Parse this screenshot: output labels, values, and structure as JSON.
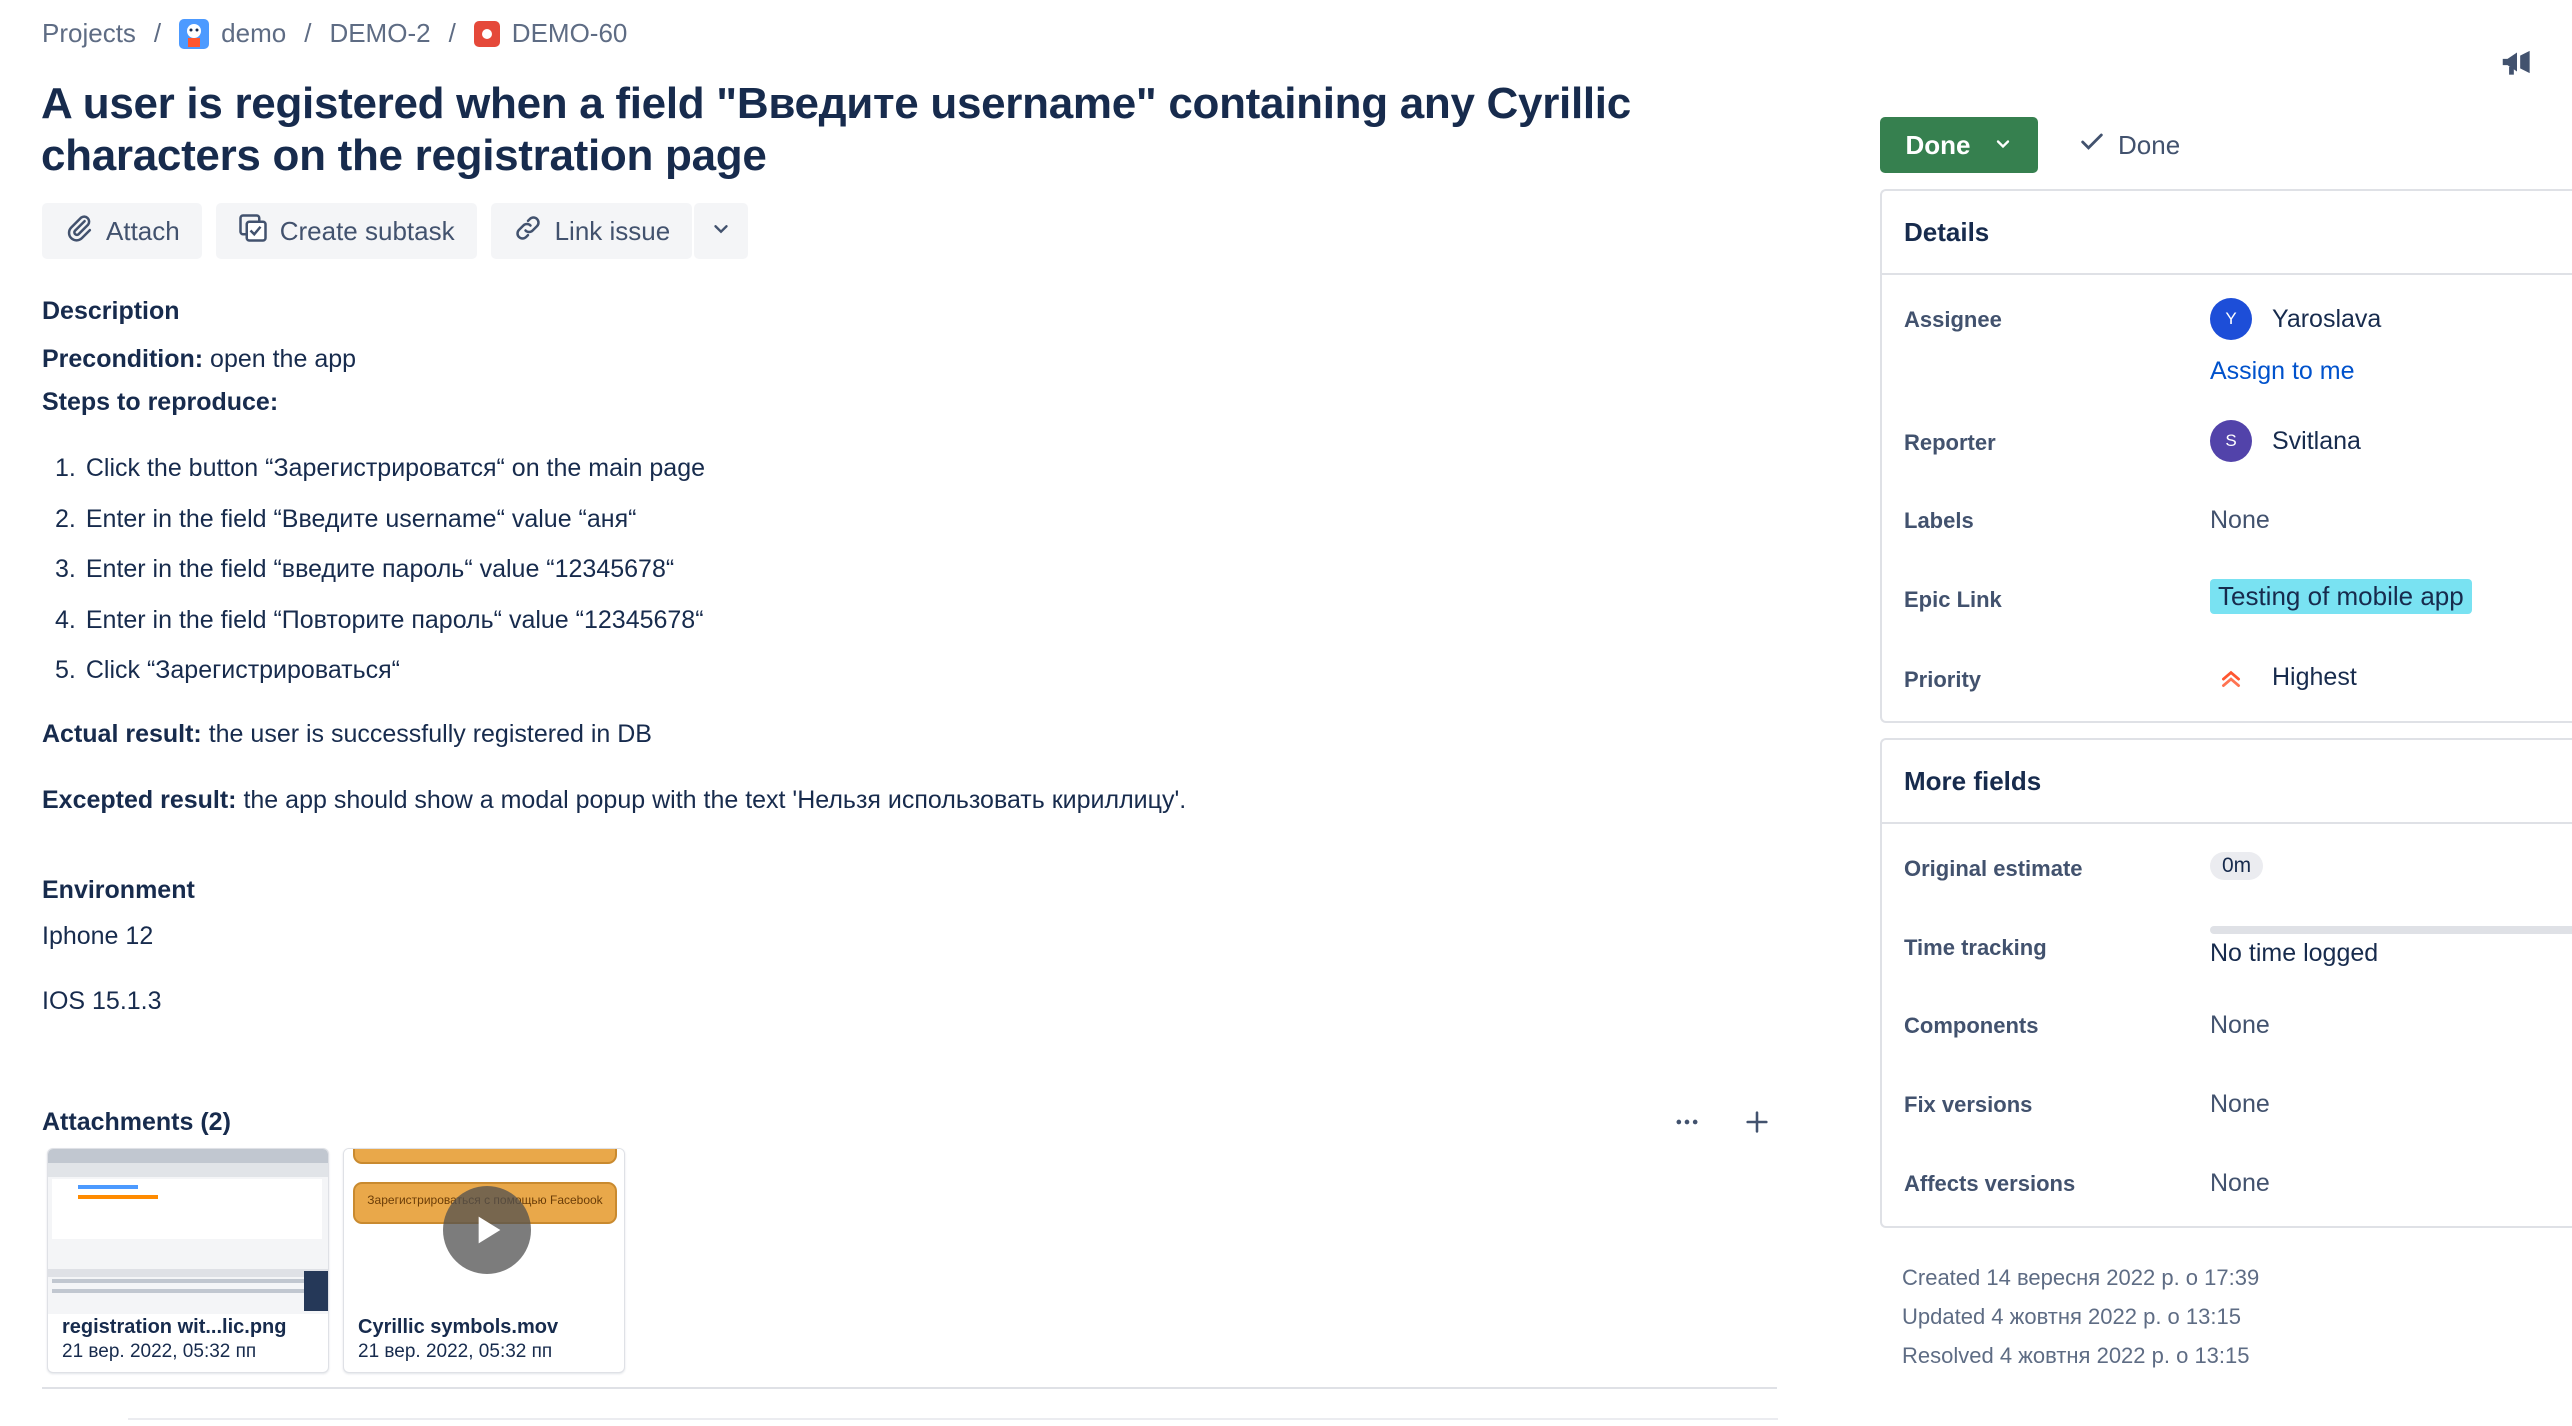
{
  "breadcrumbs": {
    "projects": "Projects",
    "project": "demo",
    "epic": "DEMO-2",
    "issue": "DEMO-60",
    "separator": "/"
  },
  "title": "A user is registered when a field \"Введите username\" containing any Cyrillic characters on the registration page",
  "toolbar": {
    "attach": "Attach",
    "create_subtask": "Create subtask",
    "link_issue": "Link issue"
  },
  "description": {
    "heading": "Description",
    "precondition_label": "Precondition:",
    "precondition_value": " open the app",
    "steps_label": "Steps to reproduce:",
    "steps": [
      {
        "num": "1.",
        "text": "Click the button “Зарегистрироватся“ on the main page"
      },
      {
        "num": "2.",
        "text": "Enter in the field “Введите username“ value “аня“"
      },
      {
        "num": "3.",
        "text": "Enter in the field “введите пароль“ value “12345678“"
      },
      {
        "num": "4.",
        "text": "Enter in the field “Повторите пароль“ value “12345678“"
      },
      {
        "num": "5.",
        "text": "Click “Зарегистрироваться“"
      }
    ],
    "actual_label": "Actual result:",
    "actual_value": " the user is successfully registered in DB",
    "expected_label": "Excepted result:",
    "expected_value": " the app should show a modal popup with the text 'Нельзя использовать кириллицу'."
  },
  "environment": {
    "heading": "Environment",
    "device": "Iphone 12",
    "os": "IOS 15.1.3"
  },
  "attachments": {
    "heading": "Attachments (2)",
    "items": [
      {
        "name": "registration wit...lic.png",
        "date": "21 вер. 2022, 05:32 пп"
      },
      {
        "name": "Cyrillic symbols.mov",
        "date": "21 вер. 2022, 05:32 пп"
      }
    ],
    "video_thumb_text": "Зарегистрироваться с помощью Facebook"
  },
  "status": {
    "button": "Done",
    "resolution": "Done",
    "button_color": "#36804f"
  },
  "details": {
    "heading": "Details",
    "assignee_label": "Assignee",
    "assignee_name": "Yaroslava",
    "assignee_initial": "Y",
    "assign_to_me": "Assign to me",
    "reporter_label": "Reporter",
    "reporter_name": "Svitlana",
    "reporter_initial": "S",
    "labels_label": "Labels",
    "labels_value": "None",
    "epic_label": "Epic Link",
    "epic_value": "Testing of mobile app",
    "priority_label": "Priority",
    "priority_value": "Highest"
  },
  "more_fields": {
    "heading": "More fields",
    "original_estimate_label": "Original estimate",
    "original_estimate_value": "0m",
    "time_tracking_label": "Time tracking",
    "time_tracking_value": "No time logged",
    "components_label": "Components",
    "components_value": "None",
    "fix_versions_label": "Fix versions",
    "fix_versions_value": "None",
    "affects_versions_label": "Affects versions",
    "affects_versions_value": "None"
  },
  "dates": {
    "created": "Created 14 вересня 2022 р. о 17:39",
    "updated": "Updated 4 жовтня 2022 р. о 13:15",
    "resolved": "Resolved 4 жовтня 2022 р. о 13:15"
  }
}
